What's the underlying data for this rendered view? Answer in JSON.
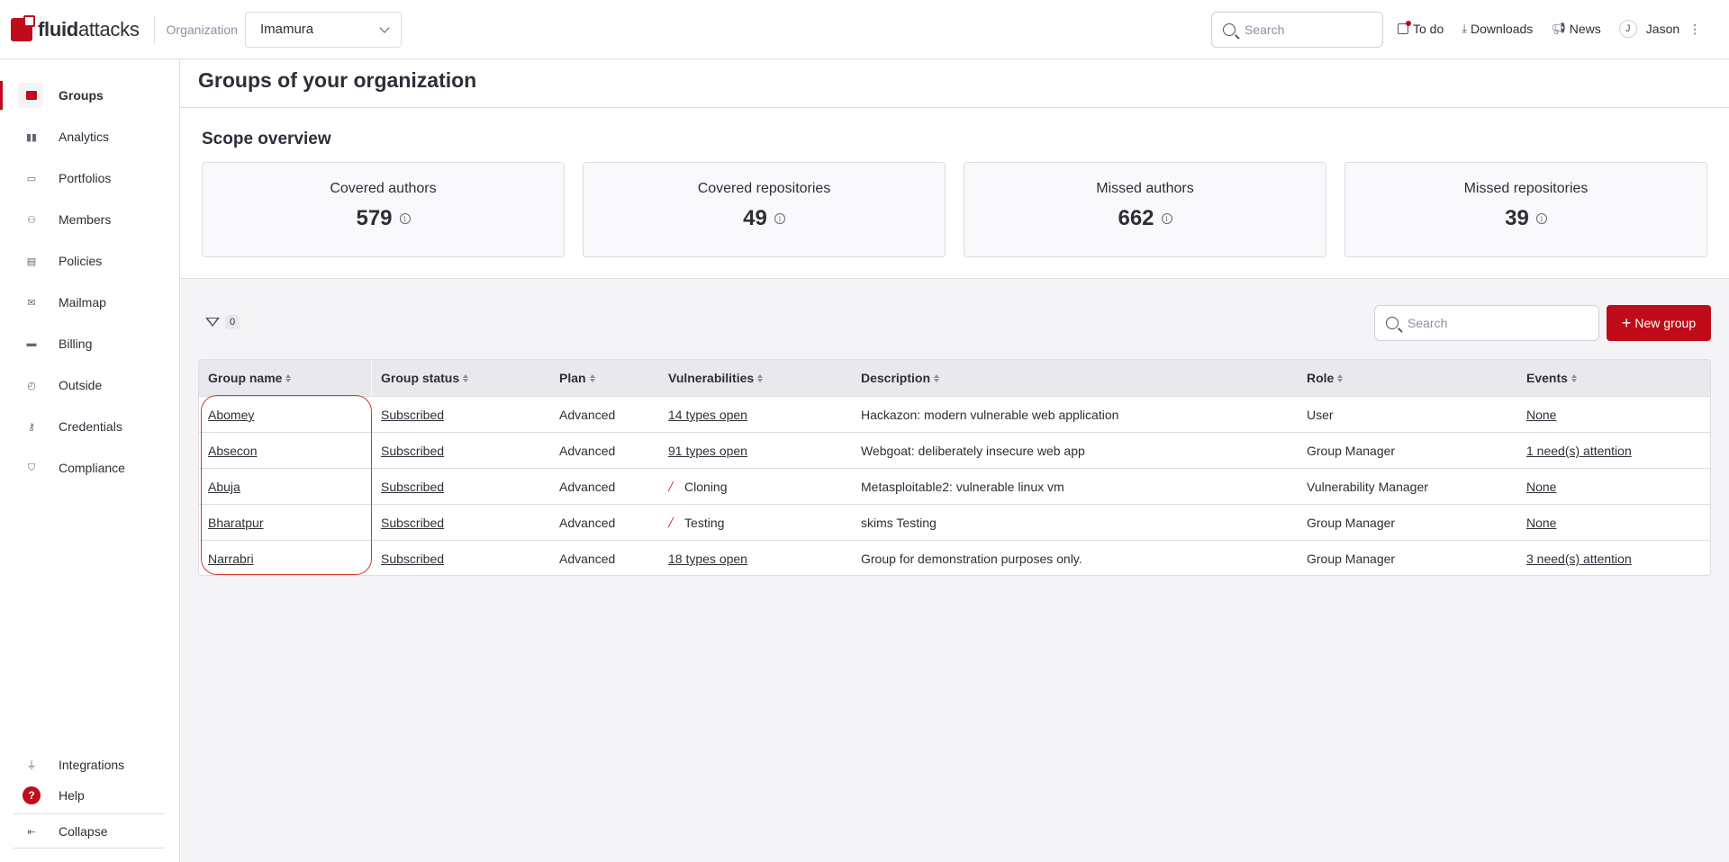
{
  "brand": {
    "logo_bold": "fluid",
    "logo_light": "attacks"
  },
  "header": {
    "org_label": "Organization",
    "org_value": "Imamura",
    "search_placeholder": "Search",
    "todo": "To do",
    "downloads": "Downloads",
    "news": "News",
    "user_initial": "J",
    "user_name": "Jason"
  },
  "sidebar": {
    "items": [
      {
        "label": "Groups",
        "icon": "folder-icon"
      },
      {
        "label": "Analytics",
        "icon": "chart-icon"
      },
      {
        "label": "Portfolios",
        "icon": "briefcase-icon"
      },
      {
        "label": "Members",
        "icon": "user-plus-icon"
      },
      {
        "label": "Policies",
        "icon": "policy-icon"
      },
      {
        "label": "Mailmap",
        "icon": "mail-icon"
      },
      {
        "label": "Billing",
        "icon": "card-icon"
      },
      {
        "label": "Outside",
        "icon": "clock-icon"
      },
      {
        "label": "Credentials",
        "icon": "key-icon"
      },
      {
        "label": "Compliance",
        "icon": "shield-icon"
      }
    ],
    "integrations": "Integrations",
    "help": "Help",
    "help_icon": "?",
    "collapse": "Collapse"
  },
  "page": {
    "title": "Groups of your organization"
  },
  "scope": {
    "title": "Scope overview",
    "cards": [
      {
        "label": "Covered authors",
        "value": "579"
      },
      {
        "label": "Covered repositories",
        "value": "49"
      },
      {
        "label": "Missed authors",
        "value": "662"
      },
      {
        "label": "Missed repositories",
        "value": "39"
      }
    ]
  },
  "toolbar": {
    "filter_count": "0",
    "search_placeholder": "Search",
    "new_group": "New group"
  },
  "table": {
    "headers": [
      "Group name",
      "Group status",
      "Plan",
      "Vulnerabilities",
      "Description",
      "Role",
      "Events"
    ],
    "rows": [
      {
        "name": "Abomey",
        "status": "Subscribed",
        "plan": "Advanced",
        "vulns": "14 types open",
        "vulns_link": true,
        "desc": "Hackazon: modern vulnerable web application",
        "role": "User",
        "events": "None"
      },
      {
        "name": "Absecon",
        "status": "Subscribed",
        "plan": "Advanced",
        "vulns": "91 types open",
        "vulns_link": true,
        "desc": "Webgoat: deliberately insecure web app",
        "role": "Group Manager",
        "events": "1 need(s) attention"
      },
      {
        "name": "Abuja",
        "status": "Subscribed",
        "plan": "Advanced",
        "vulns": "Cloning",
        "vulns_link": false,
        "desc": "Metasploitable2: vulnerable linux vm",
        "role": "Vulnerability Manager",
        "events": "None"
      },
      {
        "name": "Bharatpur",
        "status": "Subscribed",
        "plan": "Advanced",
        "vulns": "Testing",
        "vulns_link": false,
        "desc": "skims Testing",
        "role": "Group Manager",
        "events": "None"
      },
      {
        "name": "Narrabri",
        "status": "Subscribed",
        "plan": "Advanced",
        "vulns": "18 types open",
        "vulns_link": true,
        "desc": "Group for demonstration purposes only.",
        "role": "Group Manager",
        "events": "3 need(s) attention"
      }
    ]
  },
  "colors": {
    "accent": "#bf0b1a",
    "highlight": "#d23a2e"
  }
}
